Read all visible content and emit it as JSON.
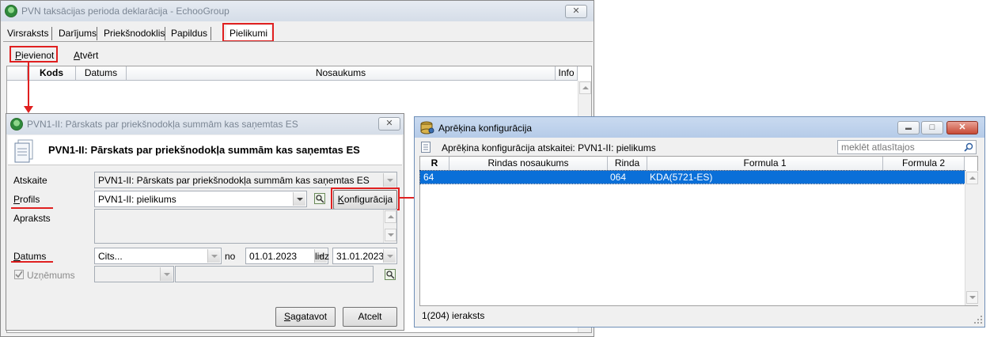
{
  "main_window": {
    "title": "PVN taksācijas perioda deklarācija - EchooGroup",
    "close_glyph": "✕",
    "tabs": [
      "Virsraksts",
      "Darījums",
      "Priekšnodoklis",
      "Papildus",
      "Pielikumi"
    ],
    "toolbar": {
      "add_label": "Pievienot",
      "open_label": "Atvērt"
    },
    "grid_columns": [
      "Kods",
      "Datums",
      "Nosaukums",
      "Info"
    ]
  },
  "dialog": {
    "title": "PVN1-II: Pārskats par priekšnodokļa summām kas saņemtas ES",
    "heading": "PVN1-II: Pārskats par priekšnodokļa summām kas saņemtas ES",
    "close_glyph": "✕",
    "report_label": "Atskaite",
    "report_value": "PVN1-II: Pārskats par priekšnodokļa summām kas saņemtas ES",
    "profile_label": "Profils",
    "profile_value": "PVN1-II: pielikums",
    "config_button": "Konfigurācija",
    "description_label": "Apraksts",
    "date_label": "Datums",
    "date_mode": "Cits...",
    "from_label": "no",
    "date_from": "01.01.2023",
    "to_label": "lidz",
    "date_to": "31.01.2023",
    "company_label": "Uzņēmums",
    "prepare_button": "Sagatavot",
    "cancel_button": "Atcelt"
  },
  "config_window": {
    "title": "Aprēķina konfigurācija",
    "subtitle": "Aprēķina konfigurācija atskaitei: PVN1-II: pielikums",
    "search_placeholder": "meklēt atlasītajos",
    "columns": [
      "R",
      "Rindas nosaukums",
      "Rinda",
      "Formula 1",
      "Formula 2"
    ],
    "rows": [
      {
        "r": "64",
        "name": "",
        "rinda": "064",
        "formula1": "KDA(5721-ES)",
        "formula2": ""
      }
    ],
    "status": "1(204) ieraksts",
    "min_glyph": "▬",
    "max_glyph": "□",
    "close_glyph": "✕"
  },
  "colors": {
    "annotation": "#e02020",
    "selection": "#0a6fd8"
  }
}
